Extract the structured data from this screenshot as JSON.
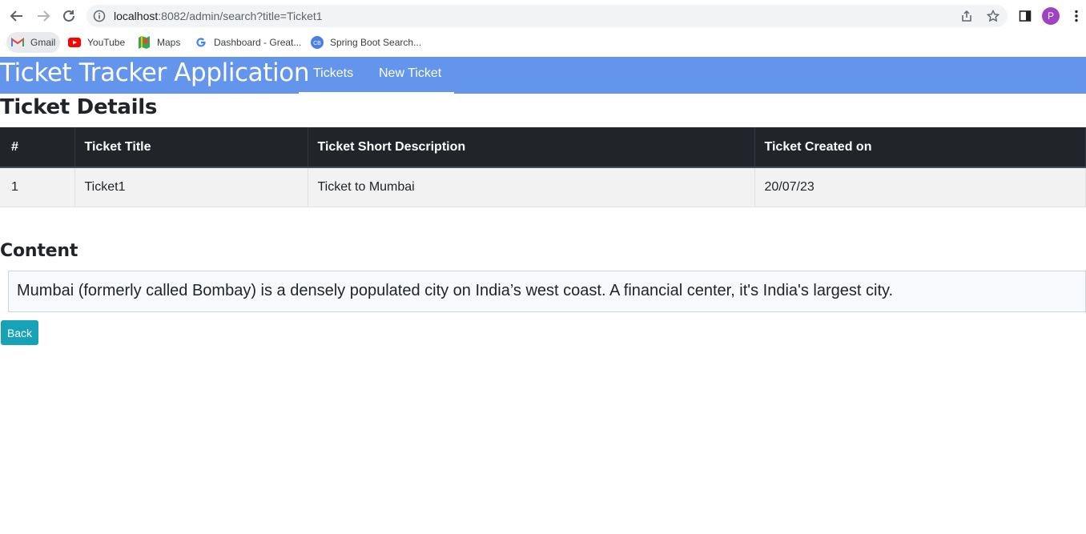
{
  "browser": {
    "url_host": "localhost",
    "url_rest": ":8082/admin/search?title=Ticket1",
    "profile_initial": "P",
    "bookmarks": [
      {
        "label": "Gmail",
        "icon": "gmail-icon"
      },
      {
        "label": "YouTube",
        "icon": "youtube-icon"
      },
      {
        "label": "Maps",
        "icon": "maps-icon"
      },
      {
        "label": "Dashboard - Great...",
        "icon": "google-icon"
      },
      {
        "label": "Spring Boot Search...",
        "icon": "cb-icon"
      }
    ],
    "cb_icon_text": "CB"
  },
  "navbar": {
    "brand": "Ticket Tracker Application",
    "links": [
      "Tickets",
      "New Ticket"
    ],
    "background": "#6495ed"
  },
  "page": {
    "title": "Ticket Details",
    "table": {
      "headers": [
        "#",
        "Ticket Title",
        "Ticket Short Description",
        "Ticket Created on"
      ],
      "rows": [
        [
          "1",
          "Ticket1",
          "Ticket to Mumbai",
          "20/07/23"
        ]
      ]
    },
    "content_heading": "Content",
    "content_text": "Mumbai (formerly called Bombay) is a densely populated city on India’s west coast. A financial center, it's India's largest city.",
    "back_label": "Back",
    "back_color": "#17a2b8"
  }
}
